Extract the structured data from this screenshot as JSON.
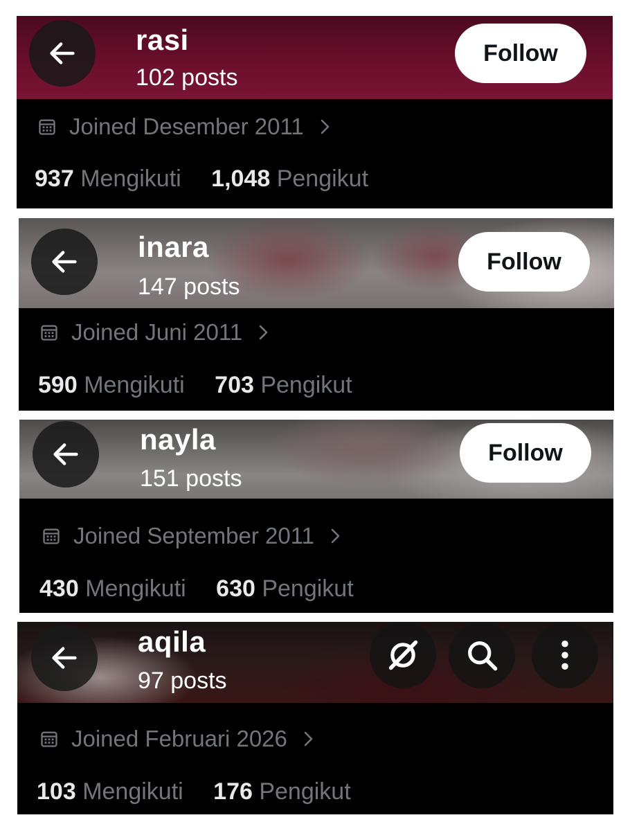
{
  "profiles": [
    {
      "name": "rasi",
      "posts": "102 posts",
      "follow_label": "Follow",
      "joined": "Joined Desember 2011",
      "following_count": "937",
      "following_label": "Mengikuti",
      "followers_count": "1,048",
      "followers_label": "Pengikut"
    },
    {
      "name": "inara",
      "posts": "147 posts",
      "follow_label": "Follow",
      "joined": "Joined Juni 2011",
      "following_count": "590",
      "following_label": "Mengikuti",
      "followers_count": "703",
      "followers_label": "Pengikut"
    },
    {
      "name": "nayla",
      "posts": "151 posts",
      "follow_label": "Follow",
      "joined": "Joined September 2011",
      "following_count": "430",
      "following_label": "Mengikuti",
      "followers_count": "630",
      "followers_label": "Pengikut"
    },
    {
      "name": "aqila",
      "posts": "97 posts",
      "joined": "Joined Februari 2026",
      "following_count": "103",
      "following_label": "Mengikuti",
      "followers_count": "176",
      "followers_label": "Pengikut"
    }
  ],
  "icons": {
    "back": "arrow-left-icon",
    "calendar": "calendar-icon",
    "chevron": "chevron-right-icon",
    "grok": "grok-icon",
    "search": "search-icon",
    "more": "more-vertical-icon"
  },
  "colors": {
    "header_maroon": "#6a0e2c",
    "card_bg": "#000000",
    "muted_text": "#71767b",
    "bold_text": "#e7e9ea",
    "follow_bg": "#ffffff"
  }
}
